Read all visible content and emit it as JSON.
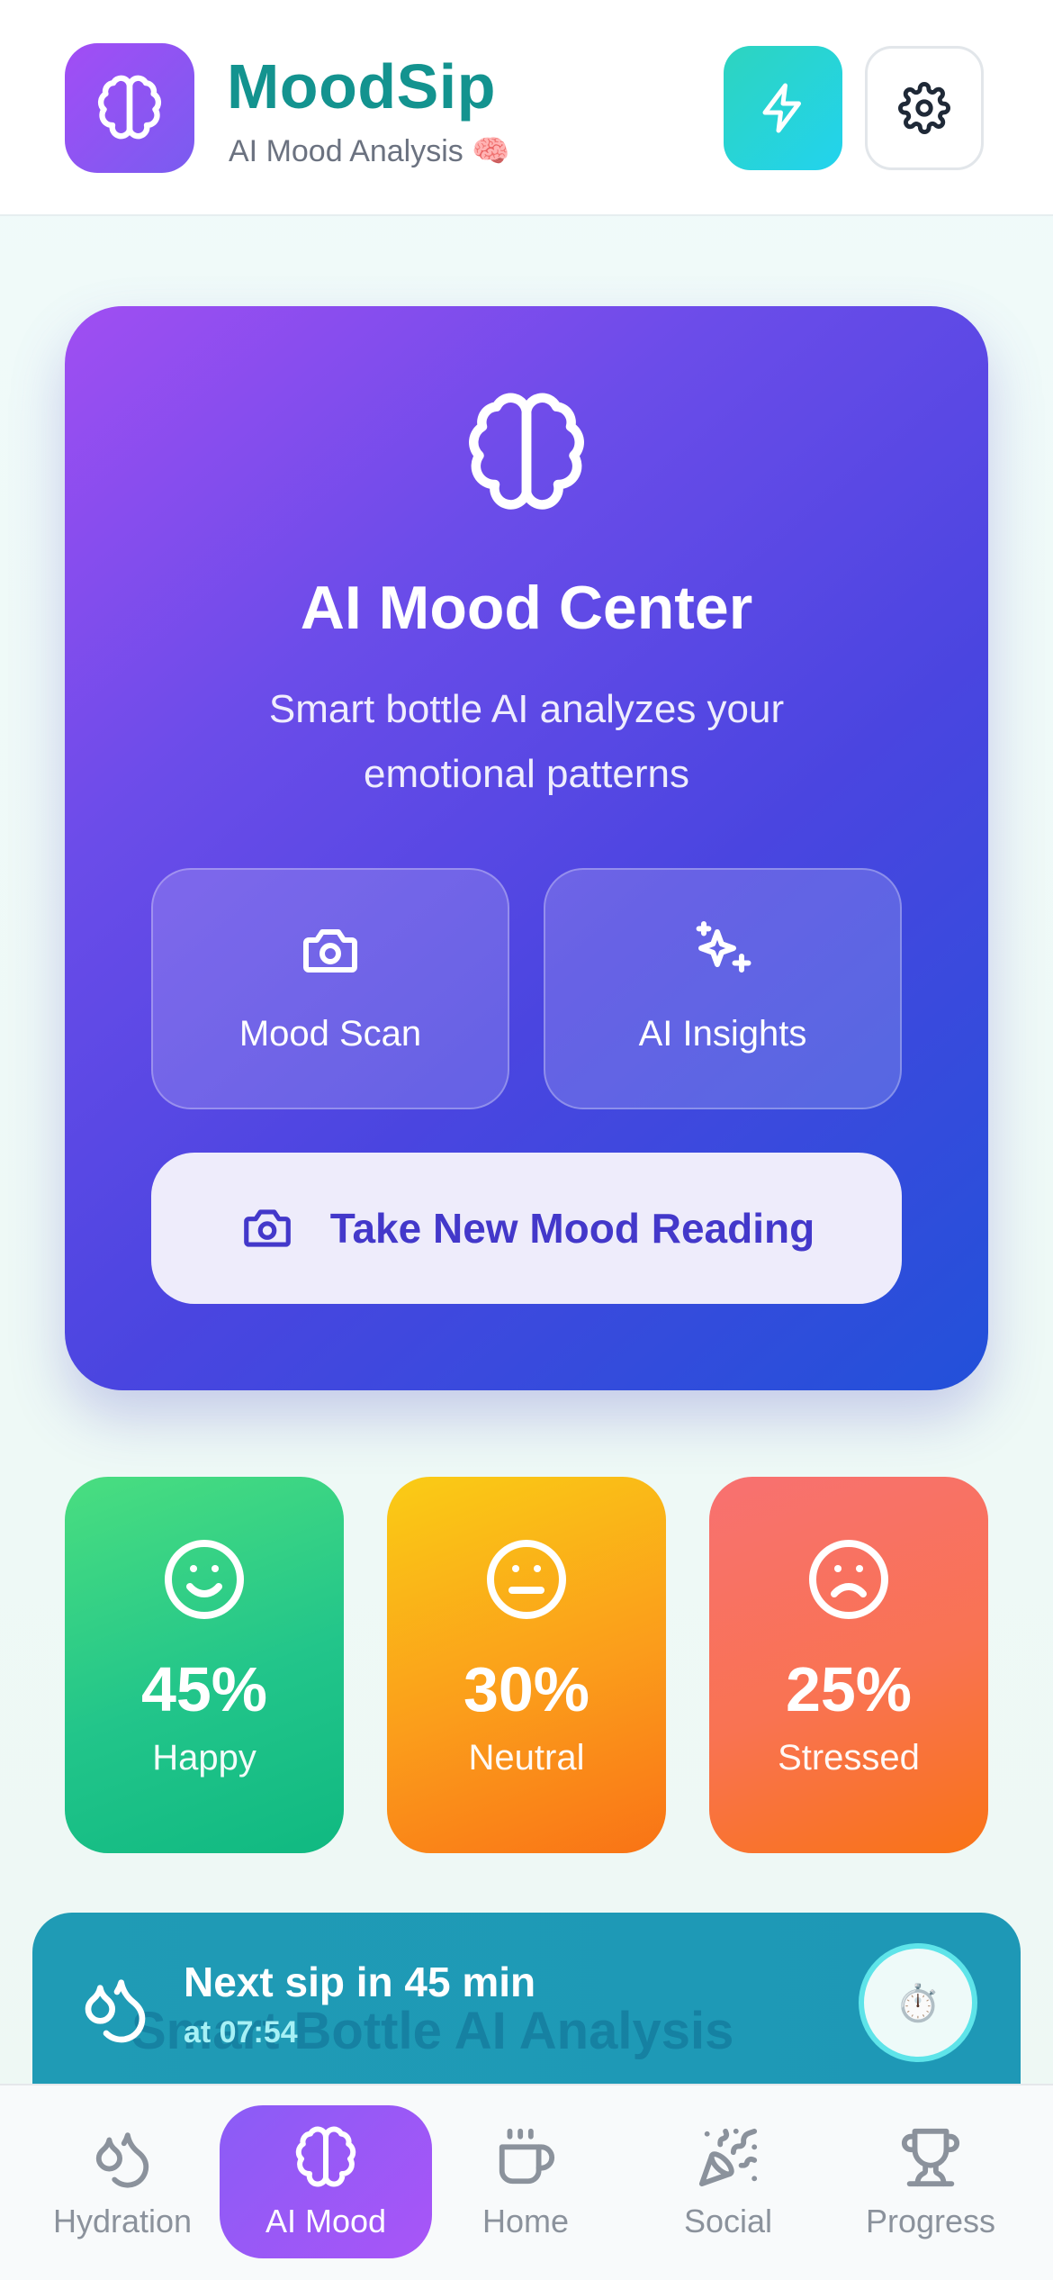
{
  "header": {
    "title": "MoodSip",
    "subtitle": "AI Mood Analysis 🧠",
    "logo_icon": "brain-icon",
    "actions": [
      {
        "icon": "lightning-icon",
        "color": "#2dd4bf"
      },
      {
        "icon": "gear-icon",
        "color": "#ffffff"
      }
    ]
  },
  "mood_center": {
    "icon": "brain-icon",
    "title": "AI Mood Center",
    "description": "Smart bottle AI analyzes your emotional patterns",
    "features": [
      {
        "label": "Mood Scan",
        "icon": "camera-icon"
      },
      {
        "label": "AI Insights",
        "icon": "sparkles-icon"
      }
    ],
    "primary_action": {
      "label": "Take New Mood Reading",
      "icon": "camera-icon"
    }
  },
  "mood_stats": [
    {
      "value": "45%",
      "label": "Happy",
      "icon": "smile-face-icon",
      "color": "#22c58a"
    },
    {
      "value": "30%",
      "label": "Neutral",
      "icon": "neutral-face-icon",
      "color": "#fb9d1b"
    },
    {
      "value": "25%",
      "label": "Stressed",
      "icon": "sad-face-icon",
      "color": "#f97352"
    }
  ],
  "reminder": {
    "title": "Next sip in 45 min",
    "time": "at 07:54",
    "obscured_text": "Smart Bottle AI Analysis",
    "timer_icon": "⏱️"
  },
  "bottom_nav": [
    {
      "label": "Hydration",
      "icon": "droplets-icon",
      "active": false
    },
    {
      "label": "AI Mood",
      "icon": "brain-icon",
      "active": true
    },
    {
      "label": "Home",
      "icon": "cup-icon",
      "active": false
    },
    {
      "label": "Social",
      "icon": "party-popper-icon",
      "active": false
    },
    {
      "label": "Progress",
      "icon": "trophy-icon",
      "active": false
    }
  ],
  "colors": {
    "brand": "#13938f",
    "accent_purple": "#8b5cf6",
    "card_indigo": "#4a45e0",
    "button_text": "#4338ca"
  }
}
